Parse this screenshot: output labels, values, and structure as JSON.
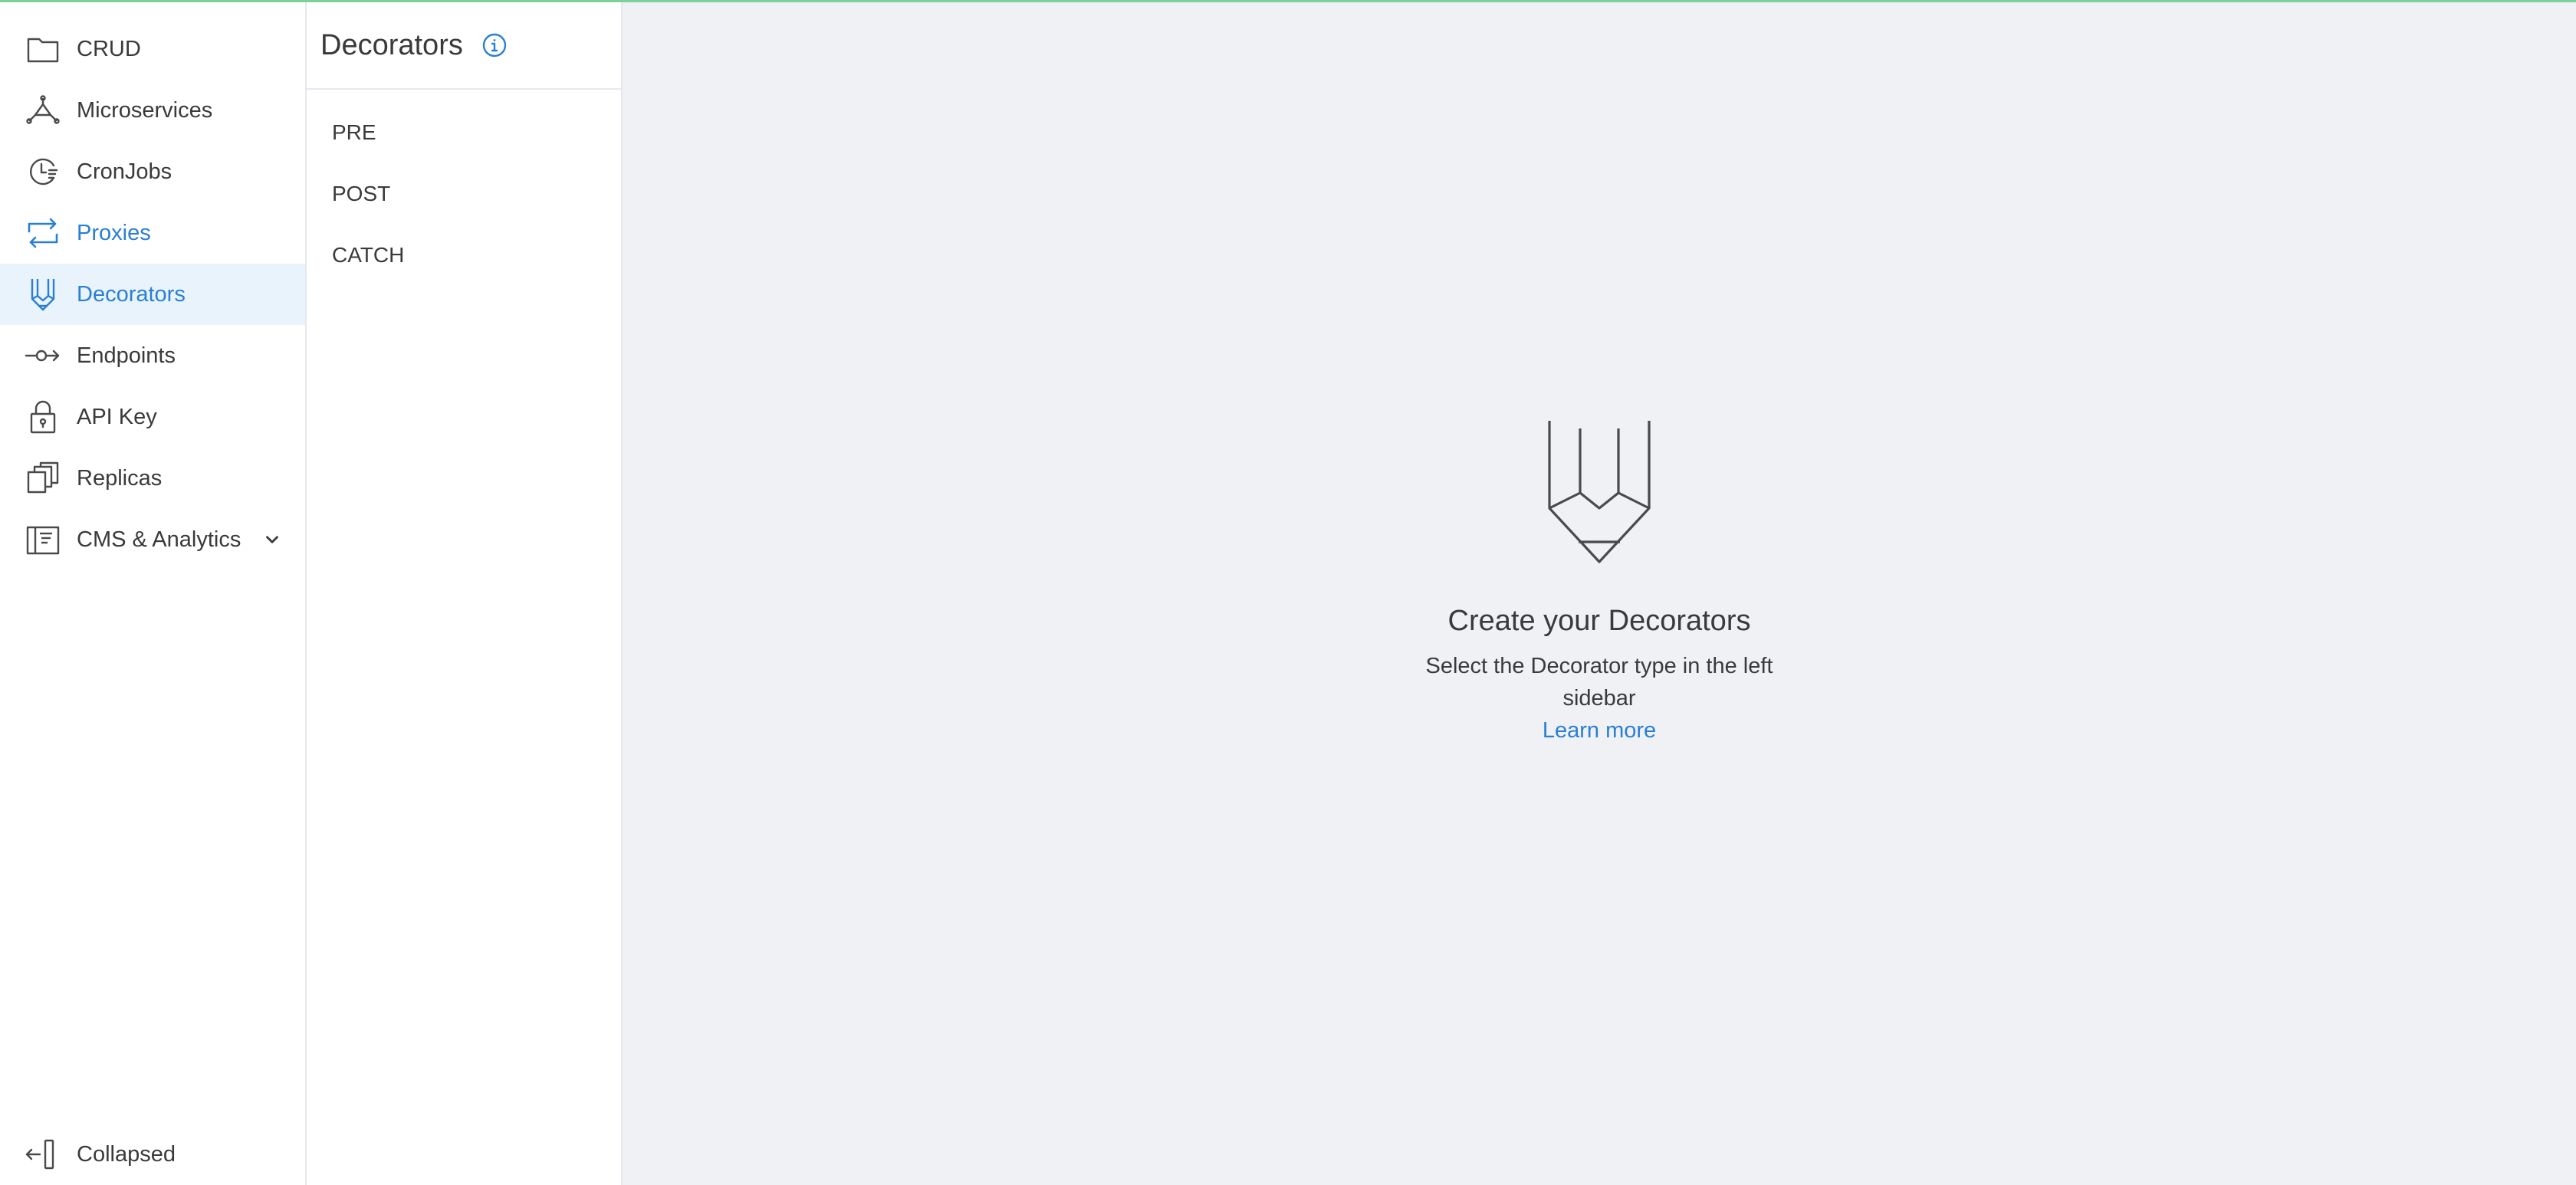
{
  "sidebar": {
    "items": [
      {
        "label": "CRUD",
        "icon": "folder-icon"
      },
      {
        "label": "Microservices",
        "icon": "microservices-icon"
      },
      {
        "label": "CronJobs",
        "icon": "clock-icon"
      },
      {
        "label": "Proxies",
        "icon": "proxy-arrows-icon"
      },
      {
        "label": "Decorators",
        "icon": "decorator-icon"
      },
      {
        "label": "Endpoints",
        "icon": "endpoint-icon"
      },
      {
        "label": "API Key",
        "icon": "lock-icon"
      },
      {
        "label": "Replicas",
        "icon": "copy-icon"
      },
      {
        "label": "CMS & Analytics",
        "icon": "cms-icon"
      }
    ],
    "active_item": "Decorators",
    "collapse_label": "Collapsed"
  },
  "subnav": {
    "title": "Decorators",
    "items": [
      {
        "label": "PRE"
      },
      {
        "label": "POST"
      },
      {
        "label": "CATCH"
      }
    ]
  },
  "main": {
    "empty_state": {
      "icon": "decorator-icon",
      "title": "Create your Decorators",
      "description": "Select the Decorator type in the left sidebar",
      "link_label": "Learn more"
    }
  },
  "colors": {
    "accent": "#2a7fd4",
    "active_bg": "#e8f3fc",
    "main_bg": "#eff1f5",
    "top_accent": "#7fcf9a"
  }
}
